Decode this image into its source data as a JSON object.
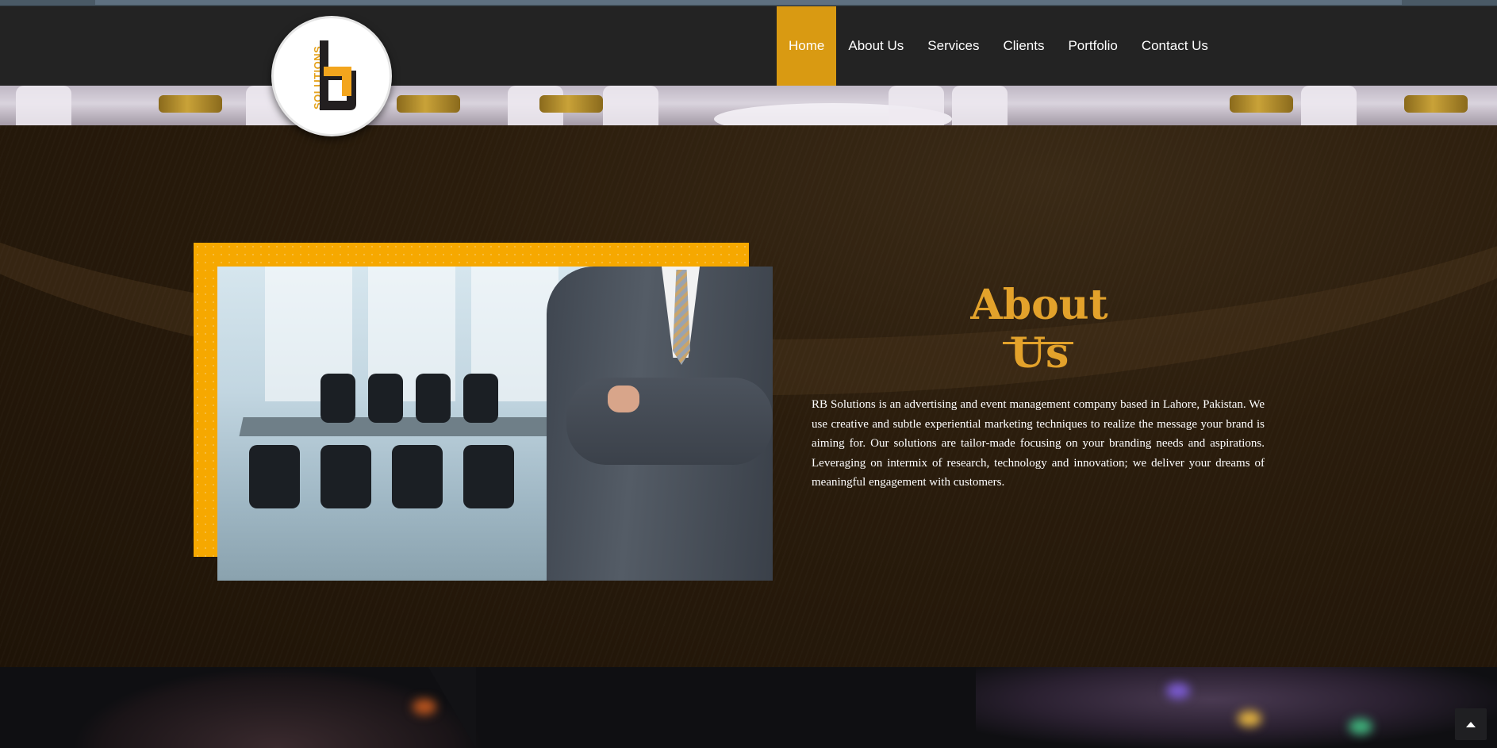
{
  "logo": {
    "wordmark": "SOLUTIONS",
    "icon": "rb-logo-icon"
  },
  "nav": {
    "items": [
      {
        "label": "Home",
        "active": true
      },
      {
        "label": "About Us",
        "active": false
      },
      {
        "label": "Services",
        "active": false
      },
      {
        "label": "Clients",
        "active": false
      },
      {
        "label": "Portfolio",
        "active": false
      },
      {
        "label": "Contact Us",
        "active": false
      }
    ]
  },
  "about": {
    "title": "About Us",
    "body": "RB Solutions is an advertising and event management company based in Lahore, Pakistan. We use creative and subtle experiential marketing techniques to realize the message your brand is aiming for. Our solutions are tailor-made focusing on your branding needs and aspirations. Leveraging on intermix of research, technology and innovation; we deliver your dreams of meaningful engagement with customers."
  },
  "scroll_top": {
    "icon": "arrow-up-icon"
  },
  "colors": {
    "accent": "#d99a12",
    "title": "#e3a22b",
    "header_bg": "#232323",
    "frame": "#f6a800"
  }
}
